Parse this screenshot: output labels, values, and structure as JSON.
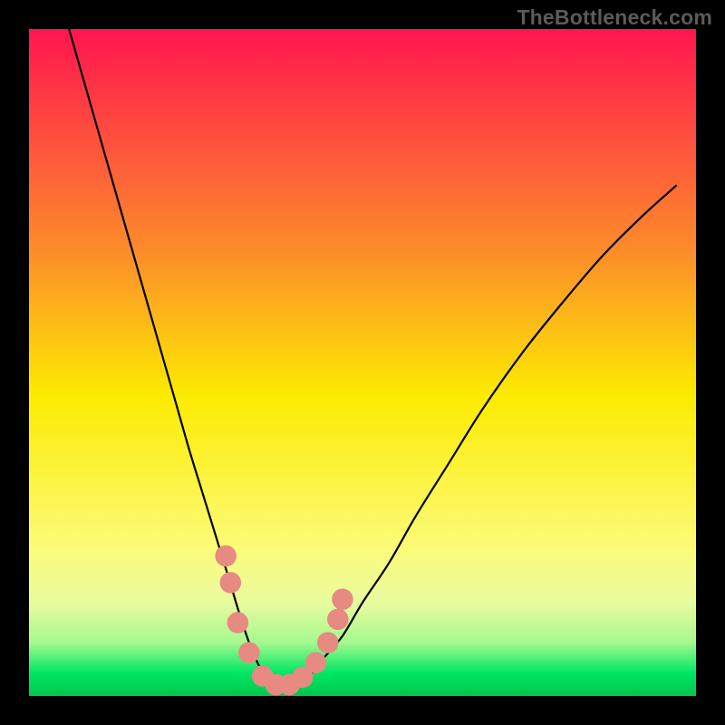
{
  "watermark": "TheBottleneck.com",
  "chart_data": {
    "type": "line",
    "title": "",
    "xlabel": "",
    "ylabel": "",
    "xlim": [
      0,
      100
    ],
    "ylim": [
      0,
      100
    ],
    "legend": "none",
    "grid": false,
    "background": {
      "gradient": [
        {
          "pos": 0.0,
          "color": "#ff154f"
        },
        {
          "pos": 0.33,
          "color": "#fd8b2b"
        },
        {
          "pos": 0.55,
          "color": "#fceb01"
        },
        {
          "pos": 0.78,
          "color": "#fcfb7a"
        },
        {
          "pos": 0.86,
          "color": "#e9fb9f"
        },
        {
          "pos": 0.92,
          "color": "#a5f98f"
        },
        {
          "pos": 0.965,
          "color": "#00e765"
        },
        {
          "pos": 1.0,
          "color": "#00c74a"
        }
      ],
      "black_frame_thickness_pct": 4
    },
    "series": [
      {
        "name": "curve",
        "color": "#000000",
        "x": [
          6,
          8,
          10,
          12,
          14,
          16,
          18,
          20,
          22,
          24,
          26,
          28,
          30,
          31.5,
          33,
          34.5,
          36,
          38,
          40,
          42,
          44,
          47,
          50,
          54,
          58,
          63,
          68,
          74,
          80,
          86,
          92,
          97
        ],
        "y": [
          100,
          93,
          86,
          79,
          72,
          65,
          58,
          51,
          44,
          37,
          30.5,
          24,
          17.5,
          12.5,
          8,
          4.5,
          2,
          1.2,
          1.5,
          3,
          5.5,
          9,
          14,
          20,
          27,
          35,
          43,
          51.5,
          59,
          66,
          72,
          76.5
        ]
      }
    ],
    "markers": {
      "name": "bottleneck-dots",
      "color": "#e78a82",
      "radius_pct": 1.6,
      "points": [
        {
          "x": 29.5,
          "y": 21
        },
        {
          "x": 30.2,
          "y": 17
        },
        {
          "x": 31.3,
          "y": 11
        },
        {
          "x": 33.0,
          "y": 6.5
        },
        {
          "x": 35.0,
          "y": 3.0
        },
        {
          "x": 37.0,
          "y": 1.7
        },
        {
          "x": 39.0,
          "y": 1.7
        },
        {
          "x": 41.0,
          "y": 2.8
        },
        {
          "x": 43.0,
          "y": 5.0
        },
        {
          "x": 44.8,
          "y": 8.0
        },
        {
          "x": 46.3,
          "y": 11.5
        },
        {
          "x": 47.0,
          "y": 14.5
        }
      ]
    }
  }
}
